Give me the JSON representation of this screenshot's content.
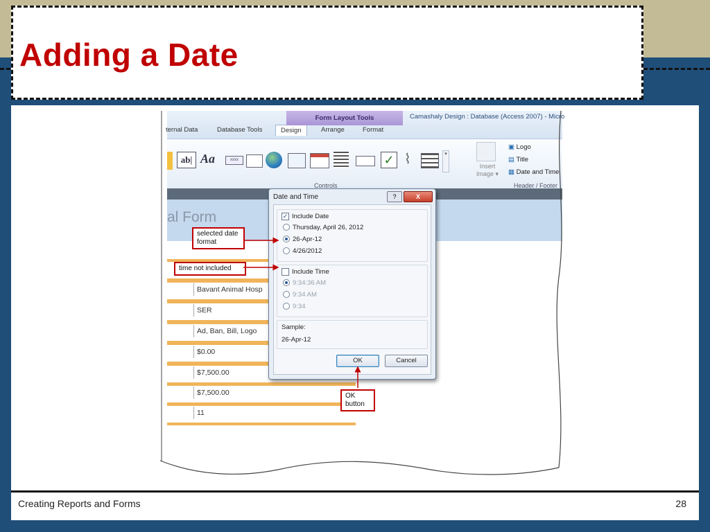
{
  "slide": {
    "title": "Adding a Date",
    "footer_left": "Creating Reports and Forms",
    "page_number": "28"
  },
  "colors": {
    "title": "#c00000",
    "navy": "#1f4e79",
    "tan": "#c2bb95",
    "field_border": "#f0b45a",
    "callout_border": "#c00000"
  },
  "ribbon": {
    "context_tab_group": "Form Layout Tools",
    "window_title": "Camashaly Design : Database (Access 2007) - Micro",
    "tabs": [
      "ternal Data",
      "Database Tools",
      "Design",
      "Arrange",
      "Format"
    ],
    "active_tab": "Design",
    "controls_group_label": "Controls",
    "header_footer_label": "Header / Footer",
    "header_footer_items": [
      "Logo",
      "Title",
      "Date and Time"
    ],
    "insert_image_label": "Insert",
    "insert_image_label2": "Image"
  },
  "form": {
    "title": "al Form",
    "fields": [
      "",
      "Bavant Animal Hosp",
      "SER",
      "Ad, Ban, Bill, Logo",
      "$0.00",
      "$7,500.00",
      "$7,500.00",
      "11"
    ]
  },
  "dialog": {
    "title": "Date and Time",
    "help": "?",
    "close": "X",
    "include_date_label": "Include Date",
    "date_formats": [
      "Thursday, April 26, 2012",
      "26-Apr-12",
      "4/26/2012"
    ],
    "selected_date_format": "26-Apr-12",
    "include_time_label": "Include Time",
    "time_formats": [
      "9:34:36 AM",
      "9:34 AM",
      "9:34"
    ],
    "sample_label": "Sample:",
    "sample_value": "26-Apr-12",
    "ok": "OK",
    "cancel": "Cancel"
  },
  "callouts": {
    "selected_date_format": "selected date format",
    "time_not_included": "time not included",
    "ok_button": "OK button"
  }
}
